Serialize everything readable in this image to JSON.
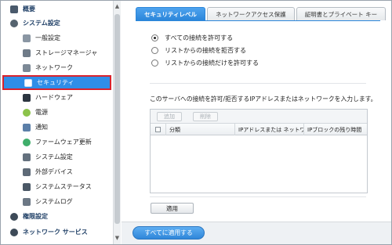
{
  "sidebar": {
    "items": [
      {
        "label": "概要",
        "icon": "grid-icon",
        "level": "top"
      },
      {
        "label": "システム設定",
        "icon": "gear-icon",
        "level": "top"
      },
      {
        "label": "一般設定",
        "icon": "general-settings-icon",
        "level": "sub"
      },
      {
        "label": "ストレージマネージャ",
        "icon": "storage-icon",
        "level": "sub"
      },
      {
        "label": "ネットワーク",
        "icon": "network-icon",
        "level": "sub"
      },
      {
        "label": "セキュリティ",
        "icon": "lock-icon",
        "level": "sub",
        "selected": true
      },
      {
        "label": "ハードウェア",
        "icon": "hardware-icon",
        "level": "sub"
      },
      {
        "label": "電源",
        "icon": "power-icon",
        "level": "sub"
      },
      {
        "label": "通知",
        "icon": "notification-icon",
        "level": "sub"
      },
      {
        "label": "ファームウェア更新",
        "icon": "firmware-icon",
        "level": "sub"
      },
      {
        "label": "システム設定",
        "icon": "system-settings-icon",
        "level": "sub"
      },
      {
        "label": "外部デバイス",
        "icon": "external-device-icon",
        "level": "sub"
      },
      {
        "label": "システムステータス",
        "icon": "status-icon",
        "level": "sub"
      },
      {
        "label": "システムログ",
        "icon": "log-icon",
        "level": "sub"
      },
      {
        "label": "権限設定",
        "icon": "user-icon",
        "level": "top"
      },
      {
        "label": "ネットワーク サービス",
        "icon": "network-service-icon",
        "level": "top"
      }
    ]
  },
  "tabs": [
    {
      "label": "セキュリティレベル",
      "active": true
    },
    {
      "label": "ネットワークアクセス保護",
      "active": false
    },
    {
      "label": "証明書とプライベート キー",
      "active": false
    }
  ],
  "security": {
    "options": [
      {
        "label": "すべての接続を許可する",
        "selected": true
      },
      {
        "label": "リストからの接続を拒否する",
        "selected": false
      },
      {
        "label": "リストからの接続だけを許可する",
        "selected": false
      }
    ],
    "description": "このサーバへの接続を許可/拒否するIPアドレスまたはネットワークを入力します。"
  },
  "table": {
    "add_label": "追加",
    "delete_label": "削除",
    "columns": [
      "分類",
      "IPアドレスまたは ネットワ...",
      "IPブロックの残り時間"
    ]
  },
  "buttons": {
    "apply": "適用",
    "apply_all": "すべてに適用する"
  },
  "colors": {
    "accent": "#2f8ee8",
    "selection_outline": "#d9232d"
  }
}
